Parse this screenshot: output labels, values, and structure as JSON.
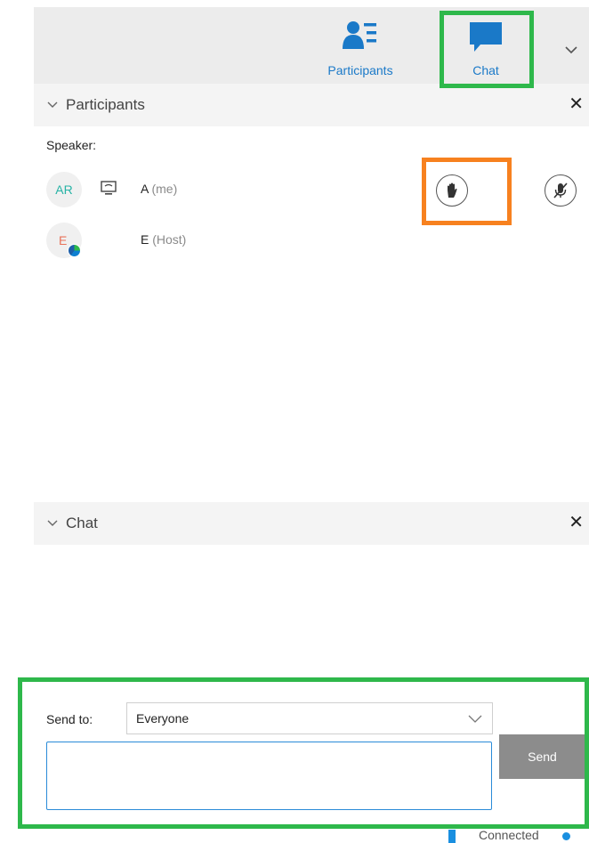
{
  "toolbar": {
    "participants_label": "Participants",
    "chat_label": "Chat"
  },
  "participants_panel": {
    "title": "Participants",
    "close": "✕",
    "speaker_label": "Speaker:",
    "people": [
      {
        "initials": "AR",
        "name": "A",
        "role": "(me)"
      },
      {
        "initials": "E",
        "name": "E",
        "role": "(Host)"
      }
    ]
  },
  "chat_panel": {
    "title": "Chat",
    "close": "✕",
    "send_to_label": "Send to:",
    "send_to_value": "Everyone",
    "message_value": "",
    "send_label": "Send"
  },
  "status": {
    "text": "Connected"
  },
  "colors": {
    "accent": "#1a79c8",
    "highlight_green": "#2eb84b",
    "highlight_orange": "#f7811f",
    "send_button": "#8c8c8c"
  }
}
